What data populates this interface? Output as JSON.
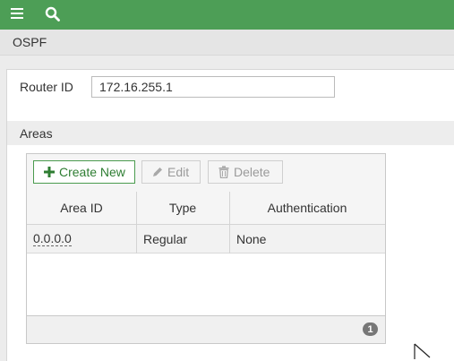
{
  "topbar": {
    "menu_icon": "hamburger-menu-icon",
    "search_icon": "search-icon",
    "color": "#4d9e56"
  },
  "section": {
    "title": "OSPF"
  },
  "router": {
    "label": "Router ID",
    "value": "172.16.255.1"
  },
  "areas": {
    "title": "Areas",
    "toolbar": {
      "create_label": "Create New",
      "edit_label": "Edit",
      "delete_label": "Delete"
    },
    "columns": [
      "Area ID",
      "Type",
      "Authentication"
    ],
    "rows": [
      {
        "area_id": "0.0.0.0",
        "type": "Regular",
        "authentication": "None"
      }
    ],
    "count": "1"
  }
}
